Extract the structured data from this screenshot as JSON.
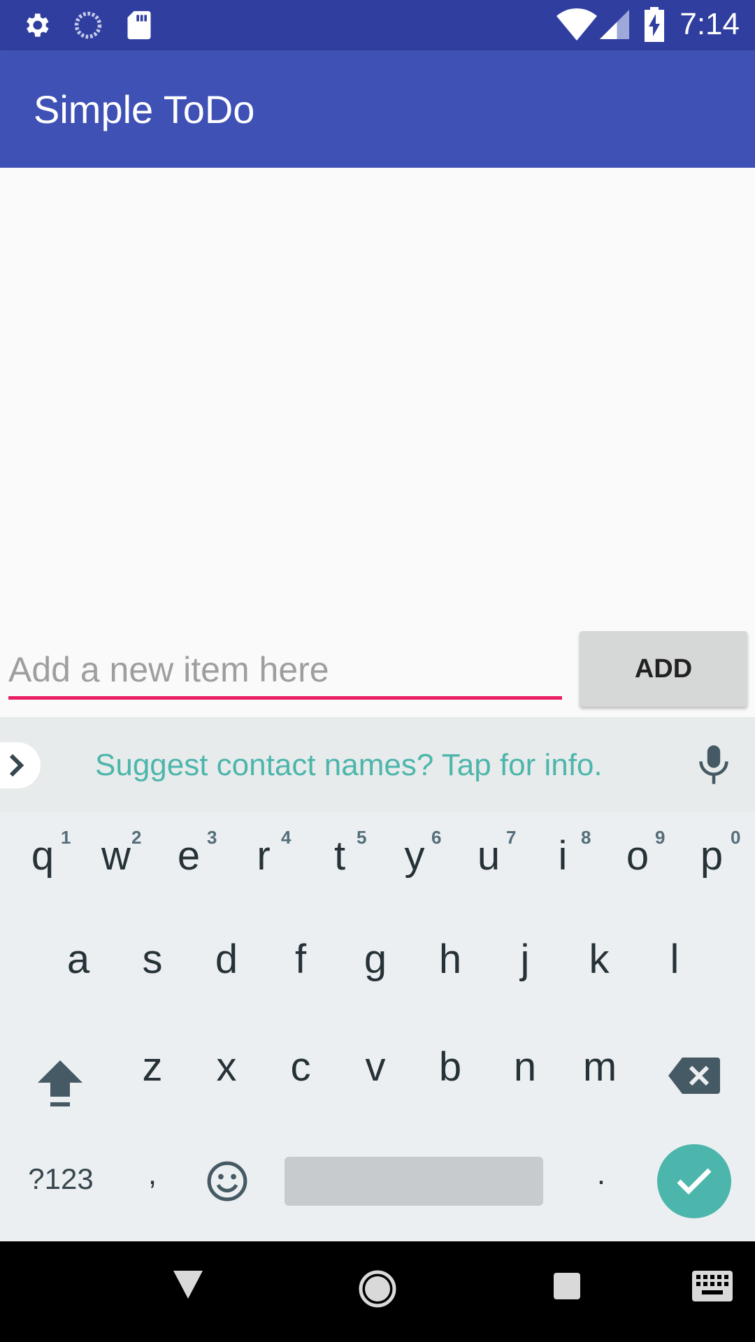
{
  "status_bar": {
    "time": "7:14",
    "icons": [
      "settings-icon",
      "sync-icon",
      "sd-card-icon",
      "wifi-icon",
      "signal-icon",
      "battery-charging-icon"
    ]
  },
  "app_bar": {
    "title": "Simple ToDo"
  },
  "input": {
    "placeholder": "Add a new item here",
    "value": ""
  },
  "add_button": {
    "label": "ADD"
  },
  "suggestion_bar": {
    "text": "Suggest contact names? Tap for info."
  },
  "keyboard": {
    "row1": [
      "q",
      "w",
      "e",
      "r",
      "t",
      "y",
      "u",
      "i",
      "o",
      "p"
    ],
    "row1_hints": [
      "1",
      "2",
      "3",
      "4",
      "5",
      "6",
      "7",
      "8",
      "9",
      "0"
    ],
    "row2": [
      "a",
      "s",
      "d",
      "f",
      "g",
      "h",
      "j",
      "k",
      "l"
    ],
    "row3": [
      "z",
      "x",
      "c",
      "v",
      "b",
      "n",
      "m"
    ],
    "symbols_key": "?123",
    "comma_key": ",",
    "period_key": "."
  },
  "colors": {
    "status_bar": "#303f9f",
    "app_bar": "#3f51b5",
    "accent": "#e91e63",
    "suggestion_text": "#4db6ac",
    "enter_key": "#4db6ac"
  }
}
